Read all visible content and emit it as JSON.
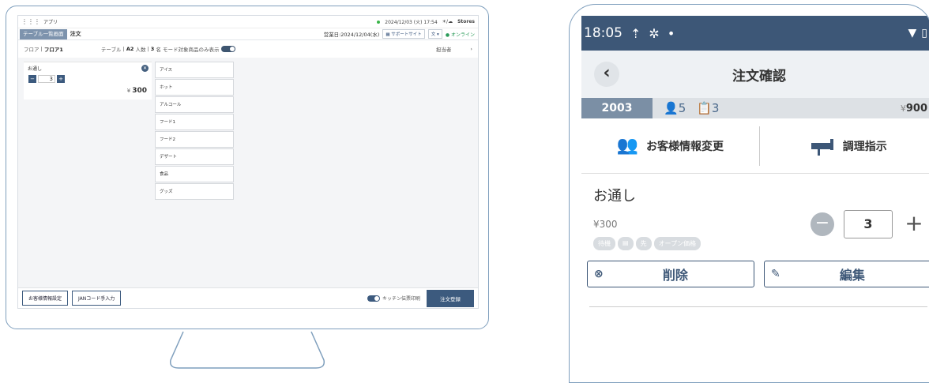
{
  "desktop": {
    "app_name": "アプリ",
    "datetime": "2024/12/03 (火) 17:54",
    "brand": "Stores",
    "tab_table_list": "テーブル一覧画面",
    "tab_order": "注文",
    "business_day": "営業日:2024/12/04(水)",
    "support_site": "サポートサイト",
    "lang": "文",
    "online": "オンライン",
    "floor_label": "フロア",
    "floor_value": "フロア1",
    "table_label": "テーブル",
    "table_value": "A2",
    "people_label": "人数",
    "people_value": "3",
    "people_unit": "名",
    "mode_label": "モード対象商品のみ表示",
    "staff_label": "担当者",
    "item": {
      "name": "お通し",
      "qty": "3",
      "yen": "¥",
      "price": "300"
    },
    "categories": [
      "アイス",
      "ホット",
      "アルコール",
      "フード1",
      "フード2",
      "デザート",
      "食品",
      "グッズ"
    ],
    "footer": {
      "customer_btn": "お客様情報設定",
      "jan_btn": "JANコード手入力",
      "kitchen_label": "キッチン伝票印刷",
      "register_btn": "注文登録"
    }
  },
  "mobile": {
    "time": "18:05",
    "title": "注文確認",
    "table_no": "2003",
    "guests": "5",
    "orders": "3",
    "yen": "¥",
    "total": "900",
    "customer_change": "お客様情報変更",
    "cooking": "調理指示",
    "item_name": "お通し",
    "item_price": "300",
    "tags": [
      "待機",
      "",
      "先",
      "オープン価格"
    ],
    "qty": "3",
    "delete": "削除",
    "edit": "編集"
  }
}
